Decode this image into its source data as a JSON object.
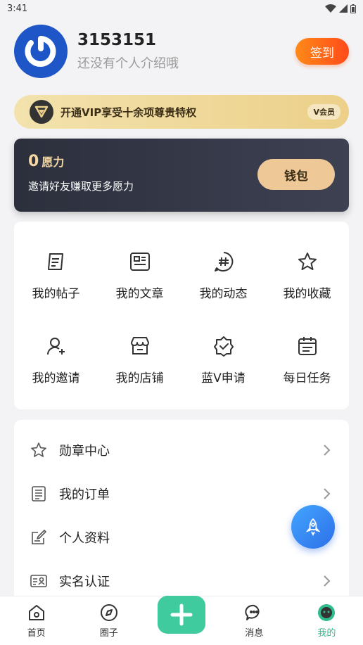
{
  "status": {
    "time": "3:41"
  },
  "profile": {
    "username": "3153151",
    "bio": "还没有个人介绍哦",
    "checkin_label": "签到"
  },
  "vip": {
    "text": "开通VIP享受十余项尊贵特权",
    "tag": "V会员"
  },
  "wallet": {
    "value": "0",
    "unit": "愿力",
    "invite": "邀请好友赚取更多愿力",
    "button": "钱包"
  },
  "grid": {
    "items": [
      {
        "label": "我的帖子",
        "icon": "posts-icon"
      },
      {
        "label": "我的文章",
        "icon": "article-icon"
      },
      {
        "label": "我的动态",
        "icon": "hashtag-icon"
      },
      {
        "label": "我的收藏",
        "icon": "star-icon"
      },
      {
        "label": "我的邀请",
        "icon": "user-add-icon"
      },
      {
        "label": "我的店铺",
        "icon": "store-icon"
      },
      {
        "label": "蓝V申请",
        "icon": "verified-badge-icon"
      },
      {
        "label": "每日任务",
        "icon": "calendar-icon"
      }
    ]
  },
  "menu": {
    "items": [
      {
        "label": "勋章中心",
        "icon": "star-outline-icon"
      },
      {
        "label": "我的订单",
        "icon": "order-list-icon"
      },
      {
        "label": "个人资料",
        "icon": "edit-profile-icon"
      },
      {
        "label": "实名认证",
        "icon": "id-card-icon"
      }
    ]
  },
  "tabs": [
    {
      "label": "首页",
      "icon": "home-icon"
    },
    {
      "label": "圈子",
      "icon": "compass-icon"
    },
    {
      "label": "",
      "icon": "plus-icon"
    },
    {
      "label": "消息",
      "icon": "message-icon"
    },
    {
      "label": "我的",
      "icon": "profile-face-icon",
      "active": true
    }
  ],
  "colors": {
    "accent": "#2fbd8f",
    "avatar_bg": "#1e56c8",
    "checkin": "#ff6a1a",
    "vip_gold": "#ecd08a",
    "wallet_dark": "#2c2f3c"
  }
}
